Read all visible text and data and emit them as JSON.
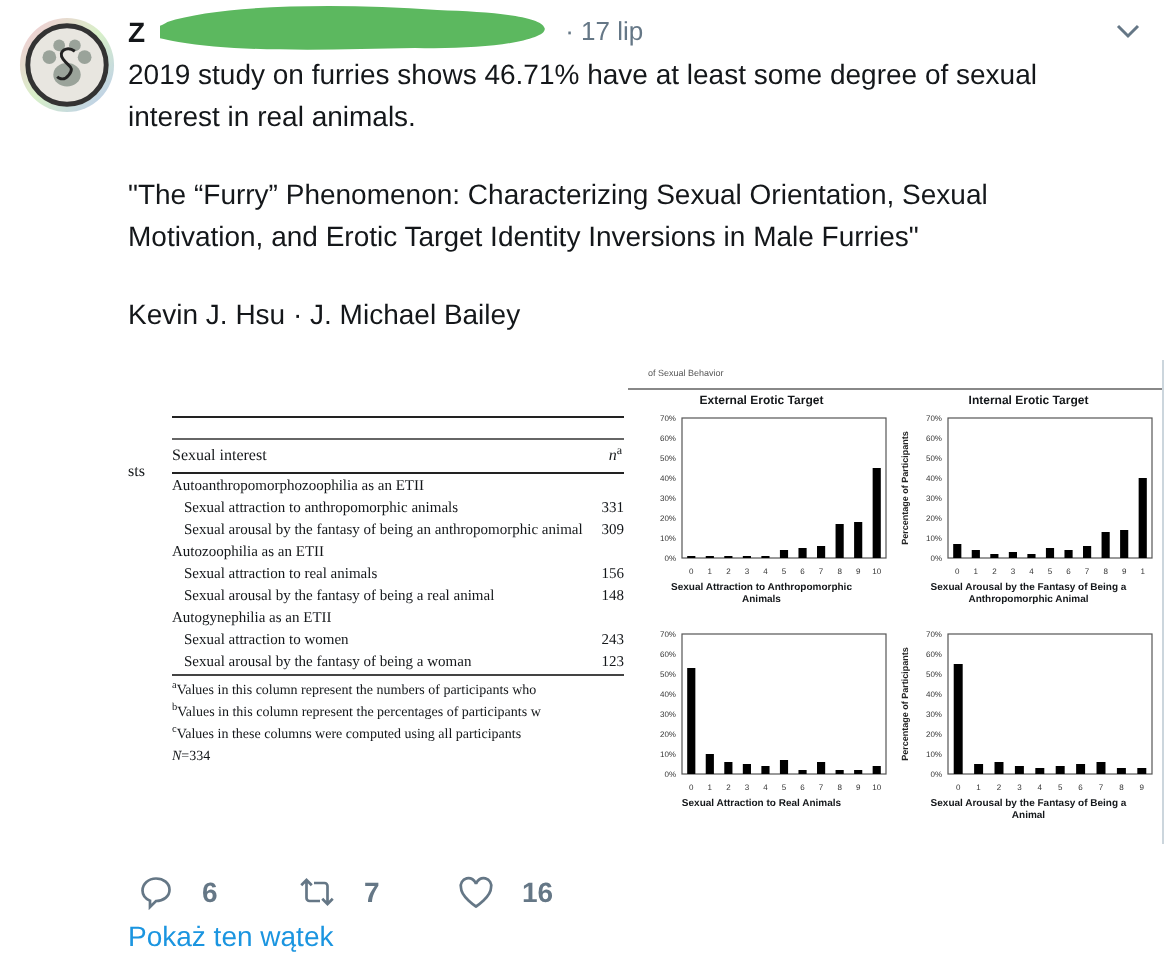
{
  "tweet": {
    "author": "Z",
    "time": "· 17 lip",
    "paragraphs": [
      "2019 study on furries shows 46.71% have at least some degree of sexual interest in real animals.",
      "\"The “Furry” Phenomenon: Characterizing Sexual Orientation, Sexual Motivation, and Erotic Target Identity Inversions in Male Furries\"",
      "Kevin J. Hsu · J. Michael Bailey"
    ]
  },
  "attachment": {
    "side_text": "sts",
    "header": "of Sexual Behavior",
    "table": {
      "columns": [
        "Sexual interest",
        "*n*$^{a}$"
      ],
      "groups": [
        {
          "label": "Autoanthropomorphozoophilia as an ETII",
          "rows": [
            {
              "label": "Sexual attraction to anthropomorphic animals",
              "n": "331"
            },
            {
              "label": "Sexual arousal by the fantasy of being an anthropomorphic animal",
              "n": "309"
            }
          ]
        },
        {
          "label": "Autozoophilia as an ETII",
          "rows": [
            {
              "label": "Sexual attraction to real animals",
              "n": "156"
            },
            {
              "label": "Sexual arousal by the fantasy of being a real animal",
              "n": "148"
            }
          ]
        },
        {
          "label": "Autogynephilia as an ETII",
          "rows": [
            {
              "label": "Sexual attraction to women",
              "n": "243"
            },
            {
              "label": "Sexual arousal by the fantasy of being a woman",
              "n": "123"
            }
          ]
        }
      ],
      "notes": [
        "$^{a}$Values in this column represent the numbers of participants who",
        "$^{b}$Values in this column represent the percentages of participants w",
        "$^{c}$Values in these columns were computed using all participants",
        "*N*=334"
      ]
    },
    "charts": [
      {
        "chart_data": {
          "type": "bar",
          "title": "External Erotic Target",
          "xlabel": "Sexual Attraction to Anthropomorphic Animals",
          "categories": [
            "0",
            "1",
            "2",
            "3",
            "4",
            "5",
            "6",
            "7",
            "8",
            "9",
            "10"
          ],
          "values": [
            1,
            1,
            1,
            1,
            1,
            4,
            5,
            6,
            17,
            18,
            45
          ],
          "ylim": [
            0,
            70
          ],
          "yticks": [
            {
              "value": 0,
              "label": "0%"
            },
            {
              "value": 10,
              "label": "10%"
            },
            {
              "value": 20,
              "label": "20%"
            },
            {
              "value": 30,
              "label": "30%"
            },
            {
              "value": 40,
              "label": "40%"
            },
            {
              "value": 50,
              "label": "50%"
            },
            {
              "value": 60,
              "label": "60%"
            },
            {
              "value": 70,
              "label": "70%"
            }
          ]
        }
      },
      {
        "chart_data": {
          "type": "bar",
          "title": "Internal Erotic Target",
          "xlabel": "Sexual Arousal by the Fantasy of Being a Anthropomorphic Animal",
          "ylabel": "Percentage of Participants",
          "categories": [
            "0",
            "1",
            "2",
            "3",
            "4",
            "5",
            "6",
            "7",
            "8",
            "9",
            "1"
          ],
          "values": [
            7,
            4,
            2,
            3,
            2,
            5,
            4,
            6,
            13,
            14,
            40
          ],
          "ylim": [
            0,
            70
          ],
          "yticks": [
            {
              "value": 0,
              "label": "0%"
            },
            {
              "value": 10,
              "label": "10%"
            },
            {
              "value": 20,
              "label": "20%"
            },
            {
              "value": 30,
              "label": "30%"
            },
            {
              "value": 40,
              "label": "40%"
            },
            {
              "value": 50,
              "label": "50%"
            },
            {
              "value": 60,
              "label": "60%"
            },
            {
              "value": 70,
              "label": "70%"
            }
          ]
        }
      },
      {
        "chart_data": {
          "type": "bar",
          "xlabel": "Sexual Attraction to Real Animals",
          "categories": [
            "0",
            "1",
            "2",
            "3",
            "4",
            "5",
            "6",
            "7",
            "8",
            "9",
            "10"
          ],
          "values": [
            53,
            10,
            6,
            5,
            4,
            7,
            2,
            6,
            2,
            2,
            4
          ],
          "ylim": [
            0,
            70
          ],
          "yticks": [
            {
              "value": 0,
              "label": "0%"
            },
            {
              "value": 10,
              "label": "10%"
            },
            {
              "value": 20,
              "label": "20%"
            },
            {
              "value": 30,
              "label": "30%"
            },
            {
              "value": 40,
              "label": "40%"
            },
            {
              "value": 50,
              "label": "50%"
            },
            {
              "value": 60,
              "label": "60%"
            },
            {
              "value": 70,
              "label": "70%"
            }
          ]
        }
      },
      {
        "chart_data": {
          "type": "bar",
          "xlabel": "Sexual Arousal by the Fantasy of Being a Animal",
          "ylabel": "Percentage of Participants",
          "categories": [
            "0",
            "1",
            "2",
            "3",
            "4",
            "5",
            "6",
            "7",
            "8",
            "9"
          ],
          "values": [
            55,
            5,
            6,
            4,
            3,
            4,
            5,
            6,
            3,
            3
          ],
          "ylim": [
            0,
            70
          ],
          "yticks": [
            {
              "value": 0,
              "label": "0%"
            },
            {
              "value": 10,
              "label": "10%"
            },
            {
              "value": 20,
              "label": "20%"
            },
            {
              "value": 30,
              "label": "30%"
            },
            {
              "value": 40,
              "label": "40%"
            },
            {
              "value": 50,
              "label": "50%"
            },
            {
              "value": 60,
              "label": "60%"
            },
            {
              "value": 70,
              "label": "70%"
            }
          ]
        }
      }
    ]
  },
  "actions": [
    {
      "kind": "reply",
      "count": "6"
    },
    {
      "kind": "retweet",
      "count": "7"
    },
    {
      "kind": "like",
      "count": "16"
    }
  ],
  "thread_link": "Pokaż ten wątek"
}
